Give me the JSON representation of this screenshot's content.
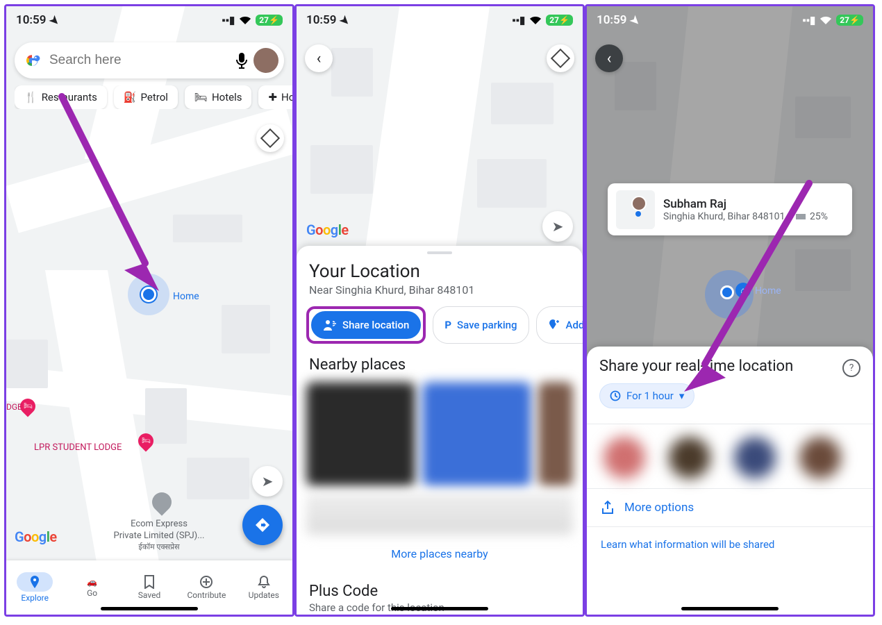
{
  "statusbar": {
    "time": "10:59",
    "battery": "27"
  },
  "screen1": {
    "search_placeholder": "Search here",
    "chips": [
      "Restaurants",
      "Petrol",
      "Hotels",
      "Hosp"
    ],
    "home_label": "Home",
    "poi_lodge_short": "DGE",
    "poi_lodge": "LPR STUDENT LODGE",
    "business_name": "Ecom Express",
    "business_sub": "Private Limited (SPJ)...",
    "business_native": "ईकॉम एक्सप्रेस",
    "nav": {
      "explore": "Explore",
      "go": "Go",
      "saved": "Saved",
      "contribute": "Contribute",
      "updates": "Updates"
    }
  },
  "screen2": {
    "sheet_title": "Your Location",
    "sheet_sub": "Near Singhia Khurd, Bihar 848101",
    "share_btn": "Share location",
    "save_parking": "Save parking",
    "add": "Add",
    "nearby_title": "Nearby places",
    "more_places": "More places nearby",
    "plus_title": "Plus Code",
    "plus_sub": "Share a code for this location"
  },
  "screen3": {
    "user_name": "Subham Raj",
    "user_location": "Singhia Khurd, Bihar 848101",
    "user_battery": "25%",
    "home_label": "Home",
    "sheet_title": "Share your real-time location",
    "duration": "For 1 hour",
    "more_options": "More options",
    "learn_link": "Learn what information will be shared"
  },
  "google": [
    "G",
    "o",
    "o",
    "g",
    "l",
    "e"
  ]
}
